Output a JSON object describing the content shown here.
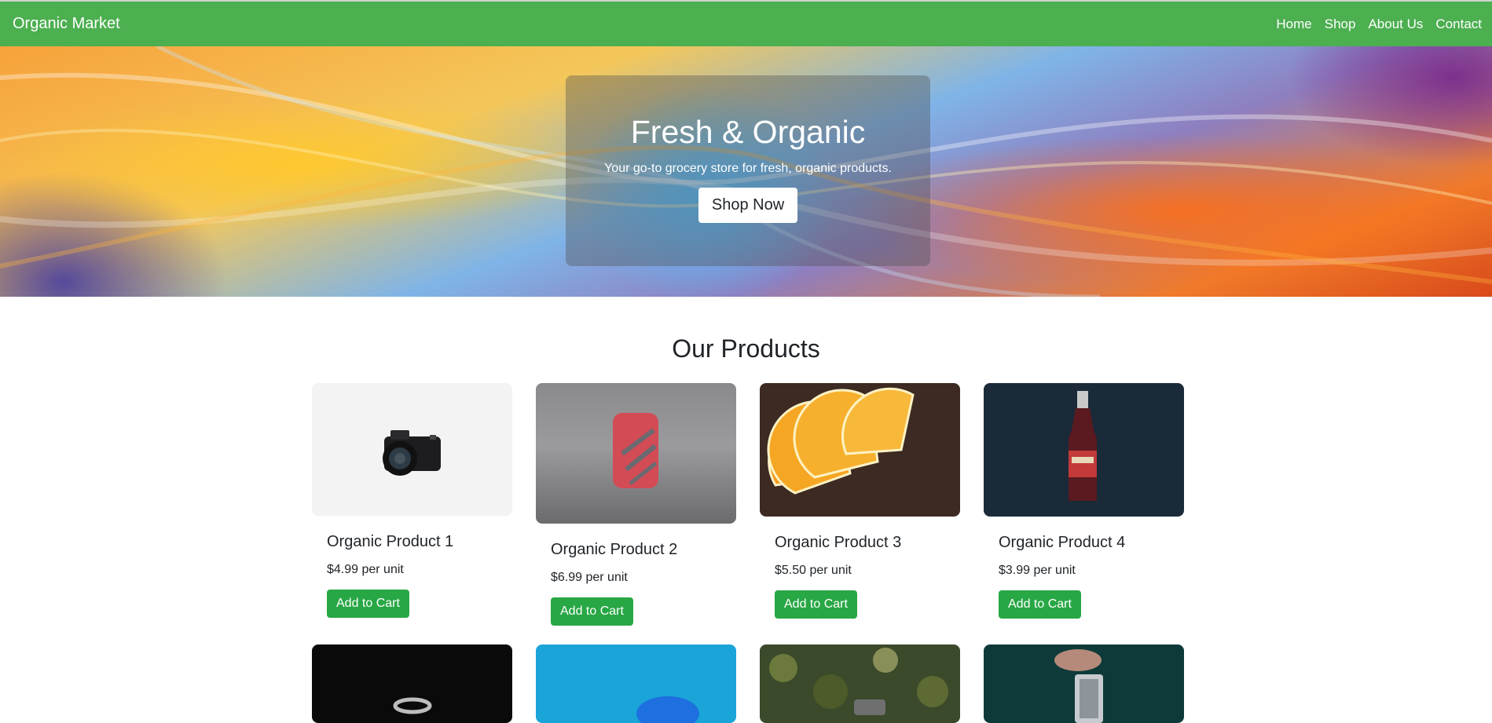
{
  "nav": {
    "brand": "Organic Market",
    "links": [
      "Home",
      "Shop",
      "About Us",
      "Contact"
    ]
  },
  "hero": {
    "title": "Fresh & Organic",
    "subtitle": "Your go-to grocery store for fresh, organic products.",
    "cta": "Shop Now"
  },
  "products_section": {
    "title": "Our Products",
    "items": [
      {
        "name": "Organic Product 1",
        "price": "$4.99 per unit",
        "button": "Add to Cart",
        "image": "camera"
      },
      {
        "name": "Organic Product 2",
        "price": "$6.99 per unit",
        "button": "Add to Cart",
        "image": "lighter"
      },
      {
        "name": "Organic Product 3",
        "price": "$5.50 per unit",
        "button": "Add to Cart",
        "image": "orange-slices"
      },
      {
        "name": "Organic Product 4",
        "price": "$3.99 per unit",
        "button": "Add to Cart",
        "image": "ginger-beer-bottle"
      },
      {
        "image": "ring"
      },
      {
        "image": "blue-object"
      },
      {
        "image": "plants"
      },
      {
        "image": "wristwatch"
      }
    ]
  }
}
